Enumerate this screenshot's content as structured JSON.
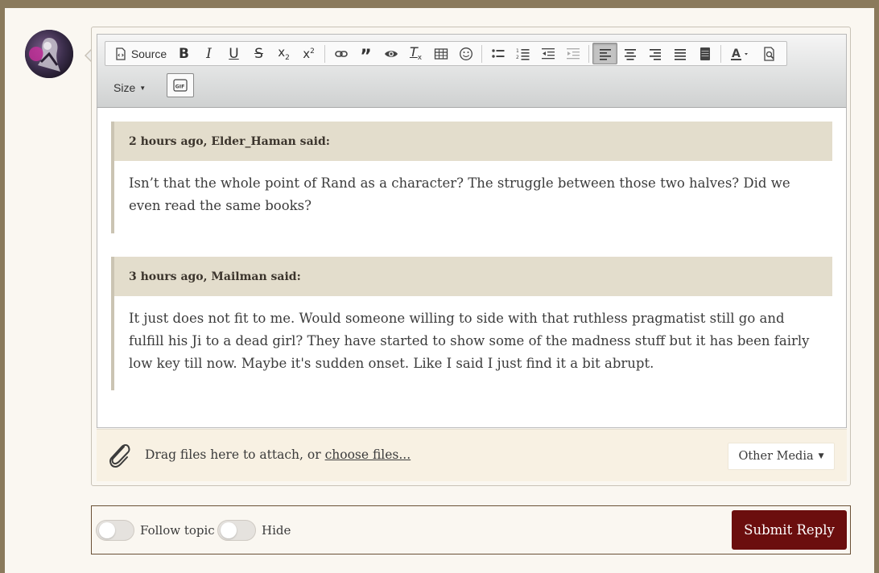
{
  "toolbar": {
    "source_label": "Source",
    "size_label": "Size"
  },
  "quotes": [
    {
      "header": "2 hours ago, Elder_Haman said:",
      "body": "Isn’t that the whole point of Rand as a character? The struggle between those two halves? Did we even read the same books?"
    },
    {
      "header": "3 hours ago, Mailman said:",
      "body": "It just does not fit to me. Would someone willing to side with that ruthless pragmatist still go and fulfill his Ji to a dead girl? They have started to show some of the madness stuff but it has been fairly low key till now. Maybe it's sudden onset. Like I said I just find it a bit abrupt."
    }
  ],
  "attach": {
    "prefix": "Drag files here to attach, or",
    "link": "choose files...",
    "other_media": "Other Media"
  },
  "footer": {
    "follow_label": "Follow topic",
    "hide_label": "Hide",
    "submit_label": "Submit Reply"
  },
  "colors": {
    "accent": "#6b0e0e",
    "quote_header": "#e3ddcc",
    "attach_bg": "#f8f1e3"
  }
}
